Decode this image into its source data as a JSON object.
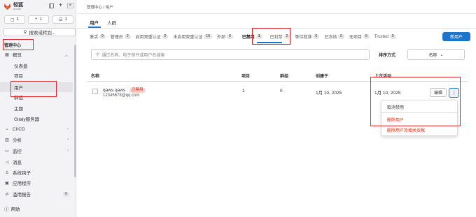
{
  "sidebar": {
    "brand_name": "轻狐",
    "brand_sub": "GITLAB",
    "counters": [
      {
        "icon": "issues-icon",
        "value": "1"
      },
      {
        "icon": "merge-request-icon",
        "value": "1"
      },
      {
        "icon": "todo-icon",
        "value": "1"
      }
    ],
    "search_label": "搜索或转到...",
    "section_label": "管理中心",
    "items": [
      {
        "label": "概览",
        "icon": "grid-icon"
      },
      {
        "label": "仪表盘"
      },
      {
        "label": "项目"
      },
      {
        "label": "用户"
      },
      {
        "label": "群组"
      },
      {
        "label": "主题"
      },
      {
        "label": "Gitaly服务器"
      },
      {
        "label": "CI/CD",
        "icon": "rocket-icon"
      },
      {
        "label": "分析",
        "icon": "chart-icon"
      },
      {
        "label": "监控",
        "icon": "monitor-icon"
      },
      {
        "label": "消息",
        "icon": "megaphone-icon"
      },
      {
        "label": "系统钩子",
        "icon": "hook-icon"
      },
      {
        "label": "应用程序",
        "icon": "apps-icon"
      },
      {
        "label": "滥用报告",
        "icon": "abuse-icon",
        "count": "0"
      }
    ],
    "help_label": "帮助"
  },
  "header": {
    "breadcrumb_root": "管理中心",
    "breadcrumb_sep": "/",
    "breadcrumb_current": "用户"
  },
  "top_tabs": [
    "用户",
    "人群"
  ],
  "filter_tabs": [
    {
      "label": "激活",
      "count": "9"
    },
    {
      "label": "管理员",
      "count": "2"
    },
    {
      "label": "启用双重认证",
      "count": "0"
    },
    {
      "label": "未启用双重认证",
      "count": "10"
    },
    {
      "label": "外部",
      "count": "0"
    },
    {
      "label": "已禁用",
      "count": "1"
    },
    {
      "label": "已封禁",
      "count": "0"
    },
    {
      "label": "等待批准",
      "count": "0"
    },
    {
      "label": "已冻结",
      "count": "0"
    },
    {
      "label": "无项目",
      "count": "6"
    },
    {
      "label": "Trusted",
      "count": "0"
    }
  ],
  "new_user_label": "新用户",
  "search": {
    "placeholder": "通过名称、电子邮件或用户名搜索"
  },
  "sort": {
    "label": "排序方式",
    "value": "名称"
  },
  "table": {
    "headers": [
      "名称",
      "项目",
      "群组",
      "创建于",
      "上次活动"
    ],
    "row": {
      "name": "qaws qaws",
      "badge": "已禁用",
      "email": "12345678@qq.com",
      "projects": "1",
      "groups": "0",
      "created": "1月 10, 2025",
      "last_activity": "1月 10, 2025",
      "edit_label": "编辑"
    }
  },
  "dropdown": {
    "items": [
      "取消禁用",
      "删除用户",
      "删除用户及相关贡献"
    ]
  },
  "colors": {
    "accent": "#1f75cb",
    "danger": "#dd2b0e",
    "annotation": "#e3262d"
  }
}
